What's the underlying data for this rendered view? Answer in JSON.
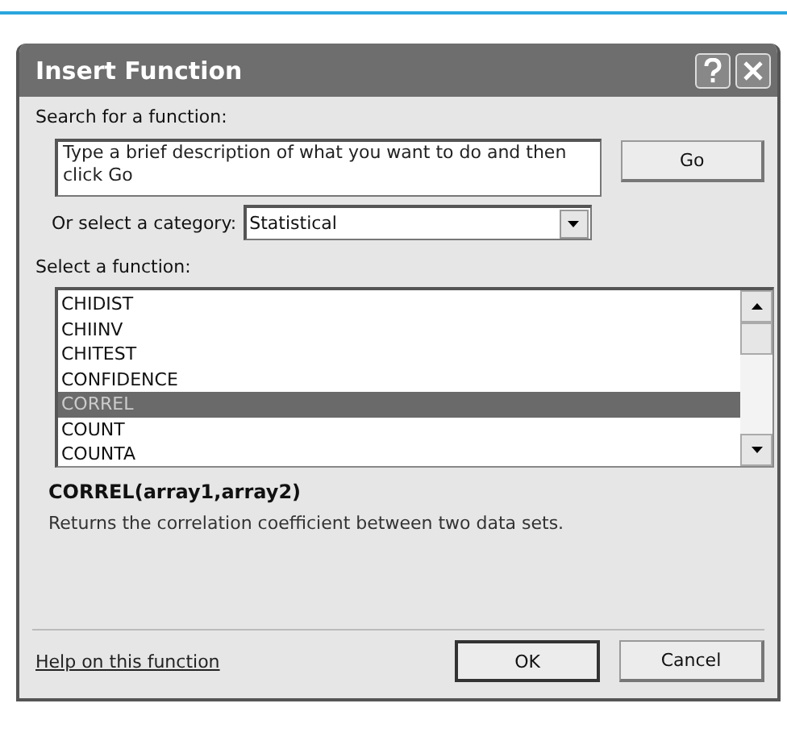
{
  "window": {
    "title": "Insert Function"
  },
  "search": {
    "label": "Search for a function:",
    "value": "Type a brief description of what you want to do and then click Go",
    "button": "Go"
  },
  "category": {
    "label": "Or select a category:",
    "value": "Statistical"
  },
  "functions": {
    "label": "Select a function:",
    "items": [
      {
        "name": "CHIDIST",
        "selected": false
      },
      {
        "name": "CHIINV",
        "selected": false
      },
      {
        "name": "CHITEST",
        "selected": false
      },
      {
        "name": "CONFIDENCE",
        "selected": false
      },
      {
        "name": "CORREL",
        "selected": true
      },
      {
        "name": "COUNT",
        "selected": false
      },
      {
        "name": "COUNTA",
        "selected": false
      }
    ]
  },
  "signature": "CORREL(array1,array2)",
  "description": "Returns the correlation coefficient between two data sets.",
  "help_link": "Help on this function",
  "buttons": [
    {
      "label": "OK",
      "kind": "default"
    },
    {
      "label": "Cancel",
      "kind": "normal"
    }
  ]
}
